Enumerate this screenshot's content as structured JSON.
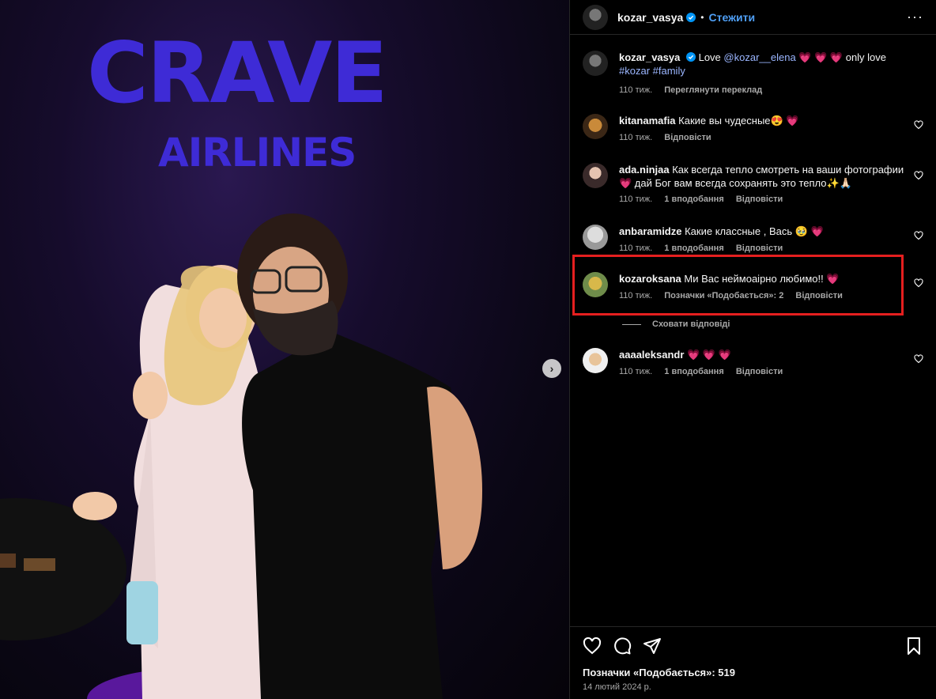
{
  "photo": {
    "sign_big": "CRAVE",
    "sign_small": "AIRLINES",
    "next_label": "›"
  },
  "header": {
    "username": "kozar_vasya",
    "dot": "•",
    "follow_label": "Стежити",
    "more_label": "···"
  },
  "caption": {
    "username": "kozar_vasya",
    "text_a": "Love",
    "mention": "@kozar__elena",
    "text_b": "💗 💗 💗 only love",
    "tag1": "#kozar",
    "tag2": "#family",
    "time": "110 тиж.",
    "translate": "Переглянути переклад"
  },
  "comments": [
    {
      "username": "kitanamafia",
      "text": "Какие вы чудесные😍 💗",
      "time": "110 тиж.",
      "likes": "",
      "reply": "Відповісти"
    },
    {
      "username": "ada.ninjaa",
      "text": "Как всегда тепло смотреть на ваши фотографии 💗 дай Бог вам всегда сохранять это тепло✨🙏🏻",
      "time": "110 тиж.",
      "likes": "1 вподобання",
      "reply": "Відповісти"
    },
    {
      "username": "anbaramidze",
      "text": "Какие классные , Вась 🥹 💗",
      "time": "110 тиж.",
      "likes": "1 вподобання",
      "reply": "Відповісти"
    },
    {
      "username": "kozaroksana",
      "text": "Ми Вас неймоаірно любимо!! 💗",
      "time": "110 тиж.",
      "likes": "Позначки «Подобається»: 2",
      "reply": "Відповісти"
    },
    {
      "username": "aaaaleksandr",
      "text": "💗 💗 💗",
      "time": "110 тиж.",
      "likes": "1 вподобання",
      "reply": "Відповісти"
    }
  ],
  "hide_replies": "Сховати відповіді",
  "footer": {
    "likes": "Позначки «Подобається»: 519",
    "date": "14 лютий 2024 р."
  },
  "colors": {
    "accent": "#4f9ff5",
    "highlight": "#e51f1f",
    "heart": "#ff3b6b",
    "sign": "#3e2bd6"
  }
}
